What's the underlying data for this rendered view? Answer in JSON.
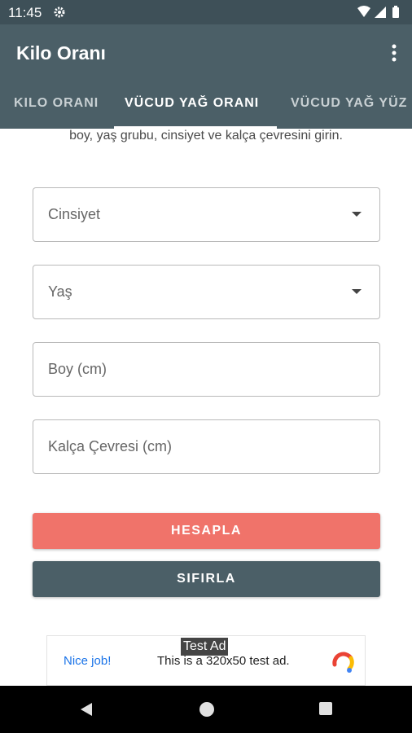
{
  "status_bar": {
    "time": "11:45",
    "icons": [
      "settings-gear-icon",
      "wifi-icon",
      "signal-icon",
      "battery-icon"
    ]
  },
  "app_bar": {
    "title": "Kilo Oranı",
    "menu_icon": "more-vert-icon"
  },
  "tabs": [
    {
      "label": "KILO ORANI",
      "active": false
    },
    {
      "label": "VÜCUD YAĞ ORANI",
      "active": true
    },
    {
      "label": "VÜCUD YAĞ YÜZ",
      "active": false
    }
  ],
  "instructions": "boy, yaş grubu, cinsiyet ve kalça çevresini girin.",
  "form": {
    "gender_label": "Cinsiyet",
    "age_label": "Yaş",
    "height_label": "Boy (cm)",
    "hip_label": "Kalça Çevresi (cm)"
  },
  "buttons": {
    "calculate": "HESAPLA",
    "reset": "SIFIRLA"
  },
  "ad": {
    "badge": "Test Ad",
    "left_text": "Nice job!",
    "main_text": "This is a 320x50 test ad."
  },
  "colors": {
    "status_bar": "#3e5058",
    "app_bar": "#4b5f67",
    "calculate_button": "#f0736a",
    "reset_button": "#4b5f67"
  },
  "nav_bar": {
    "icons": [
      "back-icon",
      "home-icon",
      "recents-icon"
    ]
  }
}
